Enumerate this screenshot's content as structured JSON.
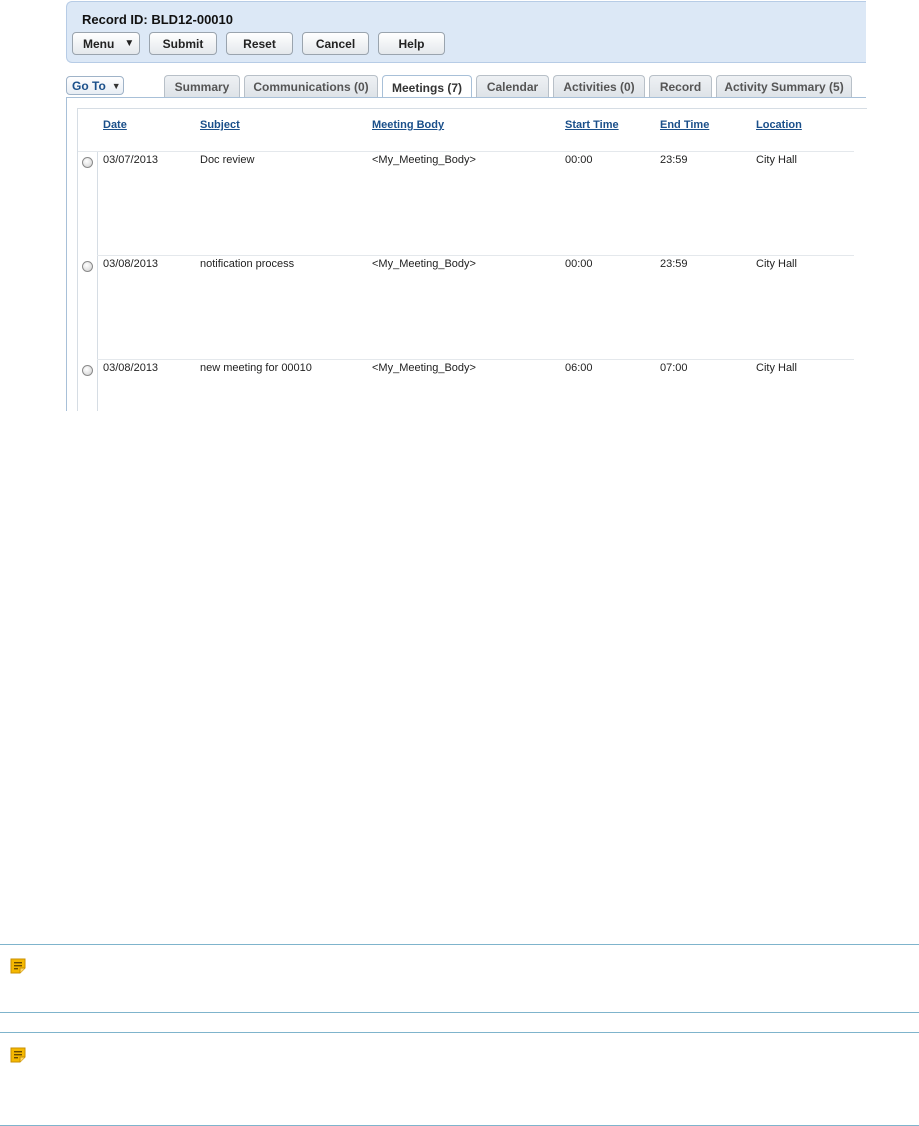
{
  "header": {
    "record_id": "Record ID: BLD12-00010",
    "buttons": {
      "menu": "Menu",
      "submit": "Submit",
      "reset": "Reset",
      "cancel": "Cancel",
      "help": "Help"
    }
  },
  "goto": {
    "label": "Go To"
  },
  "tabs": [
    {
      "label": "Summary"
    },
    {
      "label": "Communications (0)"
    },
    {
      "label": "Meetings (7)",
      "active": true
    },
    {
      "label": "Calendar"
    },
    {
      "label": "Activities (0)"
    },
    {
      "label": "Record"
    },
    {
      "label": "Activity Summary (5)"
    }
  ],
  "meetings": {
    "columns": [
      "Date",
      "Subject",
      "Meeting Body",
      "Start Time",
      "End Time",
      "Location"
    ],
    "rows": [
      {
        "date": "03/07/2013",
        "subject": "Doc review",
        "body": "<My_Meeting_Body>",
        "start": "00:00",
        "end": "23:59",
        "location": "City Hall"
      },
      {
        "date": "03/08/2013",
        "subject": "notification process",
        "body": "<My_Meeting_Body>",
        "start": "00:00",
        "end": "23:59",
        "location": "City Hall"
      },
      {
        "date": "03/08/2013",
        "subject": "new meeting for 00010",
        "body": "<My_Meeting_Body>",
        "start": "06:00",
        "end": "07:00",
        "location": "City Hall"
      }
    ]
  },
  "colors": {
    "header_bg": "#dce8f6",
    "link": "#1a4f8a",
    "note_rule": "#7fb4cc",
    "note_icon": "#f5b800"
  },
  "notes": [
    {
      "icon": "note-icon"
    },
    {
      "icon": "note-icon"
    }
  ]
}
